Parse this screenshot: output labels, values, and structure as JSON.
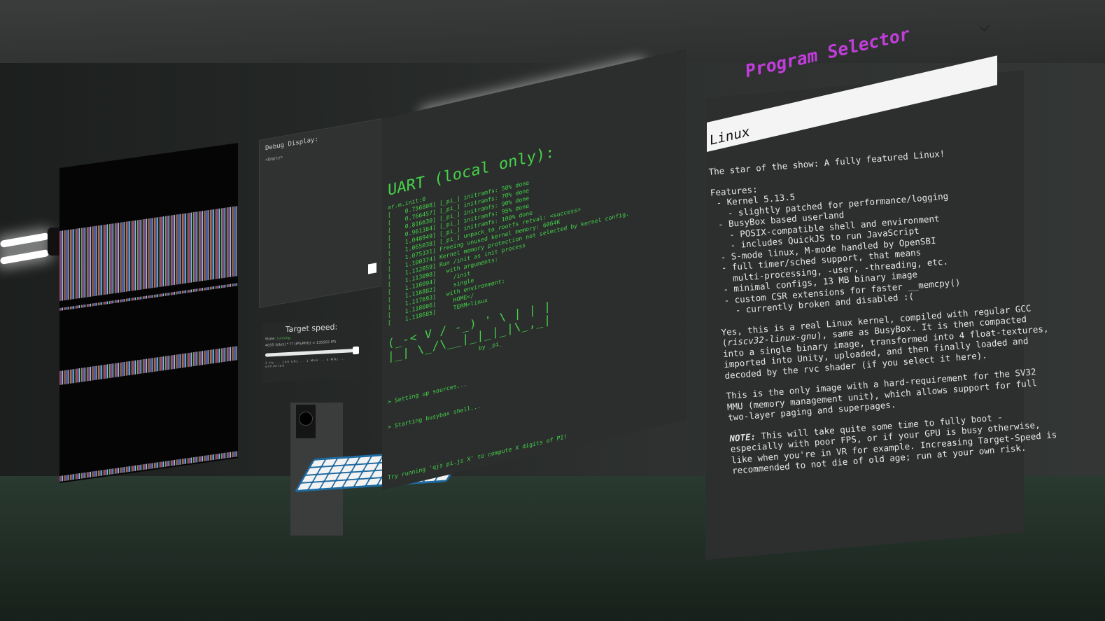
{
  "debug": {
    "title": "Debug Display:",
    "sub": "<Empty>"
  },
  "speed": {
    "title": "Target speed:",
    "state_label": "State:",
    "state_value": "running",
    "rate_line": "4055 (t/k/s) * ?? (IPS/MHz) = 135502 IPS",
    "marks": "1 Hz ... 100 kHz ... 1 MHz ... 4 MHz ... unlimited",
    "slider_value": 1.0
  },
  "uart": {
    "title": "UART (local only):",
    "lines": [
      "ar.m.init:0",
      "[    0.756808] [_pi_] initramfs: 50% done",
      "[    0.766457] [_pi_] initramfs: 70% done",
      "[    0.816630] [_pi_] initramfs: 90% done",
      "[    0.961384] [_pi_] initramfs: 95% done",
      "[    1.048949] [_pi_] initramfs: 100% done",
      "[    1.065038] [_pi_] unpack_to_rootfs retval: <success>",
      "[    1.075331] Freeing unused kernel memory: 6064K",
      "[    1.100374] Kernel memory protection not selected by kernel config.",
      "[    1.112059] Run /init as init process",
      "[    1.113098]   with arguments:",
      "[    1.116094]     /init",
      "[    1.116882]     single",
      "[    1.117693]   with environment:",
      "[    1.118086]     HOME=/",
      "[    1.118685]     TERM=linux"
    ],
    "art": "(_-< V / -_) ' \\ | | |\n|_| \\_/\\__|_|_|_|\\_,_|",
    "art_by": "by _pi_",
    "tail1": "> Setting up sources...",
    "tail2": "> Starting busybox shell...",
    "tail3": "Try running 'qjs pi.js X' to compute X digits of PI!",
    "prompt": "/ #"
  },
  "selector": {
    "title": "Program Selector",
    "selected": "Linux",
    "chevron_icon": "chevron-down-icon",
    "intro": "The star of the show: A fully featured Linux!",
    "features": "Features:\n - Kernel 5.13.5\n   - slightly patched for performance/logging\n - BusyBox based userland\n   - POSIX-compatible shell and environment\n   - includes QuickJS to run JavaScript\n - S-mode linux, M-mode handled by OpenSBI\n - full timer/sched support, that means\n   multi-processing, -user, -threading, etc.\n - minimal configs, 13 MB binary image\n - custom CSR extensions for faster __memcpy()\n   - currently broken and disabled :(",
    "para1_a": "Yes, this is a real Linux kernel, compiled with regular GCC (",
    "para1_em": "riscv32-linux-gnu",
    "para1_b": "), same as BusyBox. It is then compacted into a single binary image, transformed into 4 float-textures, imported into Unity, uploaded, and then finally loaded and decoded by the rvc shader (if you select it here).",
    "para2": "This is the only image with a hard-requirement for the SV32 MMU (memory management unit), which allows support for full two-layer paging and superpages.",
    "note_label": "NOTE:",
    "note_text": " This will take quite some time to fully boot - especially with poor FPS, or if your GPU is busy otherwise, like when you're in VR for example. Increasing Target-Speed is recommended to not die of old age; run at your own risk."
  }
}
